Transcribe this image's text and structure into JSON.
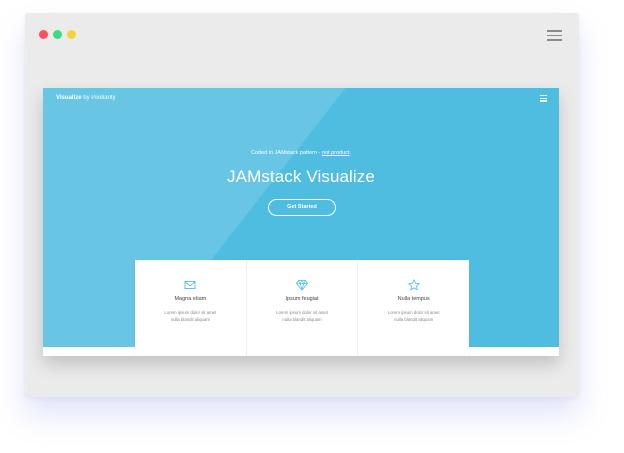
{
  "site": {
    "brand": {
      "name": "Visualize",
      "by": "by Pixelarity"
    },
    "tagline": {
      "prefix": "Coded in JAMstack pattern - ",
      "link": "not product",
      "suffix": "."
    },
    "title": "JAMstack Visualize",
    "cta_label": "Get Started",
    "hero_color": "#4fbde0"
  },
  "features": [
    {
      "icon": "envelope-icon",
      "title": "Magna etiam",
      "line1": "Lorem ipsum dolor sit amet",
      "line2": "nulla blandit aliquam"
    },
    {
      "icon": "diamond-icon",
      "title": "Ipsum feugiat",
      "line1": "Lorem ipsum dolor sit amet",
      "line2": "nulla blandit aliquam"
    },
    {
      "icon": "star-icon",
      "title": "Nulla tempus",
      "line1": "Lorem ipsum dolor sit amet",
      "line2": "nulla blandit aliquam"
    }
  ]
}
